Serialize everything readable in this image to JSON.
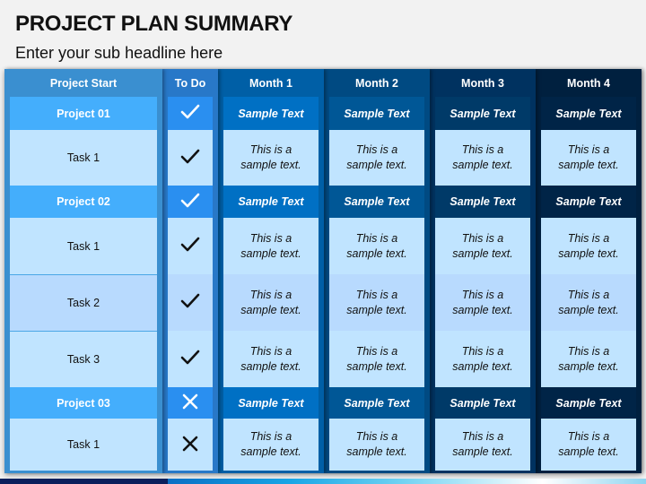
{
  "page": {
    "title": "PROJECT PLAN SUMMARY",
    "subtitle": "Enter your sub headline here"
  },
  "colors": {
    "project_start": {
      "header": "#3a8fd0",
      "project_cell": "#44aefc"
    },
    "todo": {
      "header": "#2878c8",
      "project_cell": "#2a8ff0"
    },
    "month1": {
      "header": "#005fa6",
      "project_cell": "#0070c4"
    },
    "month2": {
      "header": "#004a82",
      "project_cell": "#005796"
    },
    "month3": {
      "header": "#003260",
      "project_cell": "#003a68"
    },
    "month4": {
      "header": "#00203f",
      "project_cell": "#002447"
    }
  },
  "table": {
    "headers": {
      "project_start": "Project Start",
      "todo": "To Do",
      "month1": "Month 1",
      "month2": "Month 2",
      "month3": "Month 3",
      "month4": "Month 4"
    },
    "rows": [
      {
        "type": "project",
        "label": "Project 01",
        "todo_icon": "check-icon",
        "months": [
          "Sample Text",
          "Sample Text",
          "Sample Text",
          "Sample Text"
        ]
      },
      {
        "type": "task",
        "label": "Task 1",
        "todo_icon": "check-icon",
        "months": [
          "This is a sample text.",
          "This is a sample text.",
          "This is a sample text.",
          "This is a sample text."
        ]
      },
      {
        "type": "project",
        "label": "Project 02",
        "todo_icon": "check-icon",
        "months": [
          "Sample Text",
          "Sample Text",
          "Sample Text",
          "Sample Text"
        ]
      },
      {
        "type": "task",
        "label": "Task 1",
        "todo_icon": "check-icon",
        "months": [
          "This is a sample text.",
          "This is a sample text.",
          "This is a sample text.",
          "This is a sample text."
        ]
      },
      {
        "type": "task",
        "label": "Task 2",
        "todo_icon": "check-icon",
        "months": [
          "This is a sample text.",
          "This is a sample text.",
          "This is a sample text.",
          "This is a sample text."
        ]
      },
      {
        "type": "task",
        "label": "Task 3",
        "todo_icon": "check-icon",
        "months": [
          "This is a sample text.",
          "This is a sample text.",
          "This is a sample text.",
          "This is a sample text."
        ]
      },
      {
        "type": "project",
        "label": "Project 03",
        "todo_icon": "cross-icon",
        "months": [
          "Sample Text",
          "Sample Text",
          "Sample Text",
          "Sample Text"
        ]
      },
      {
        "type": "task",
        "label": "Task 1",
        "todo_icon": "cross-icon",
        "months": [
          "This is a sample text.",
          "This is a sample text.",
          "This is a sample text.",
          "This is a sample text."
        ]
      }
    ]
  }
}
